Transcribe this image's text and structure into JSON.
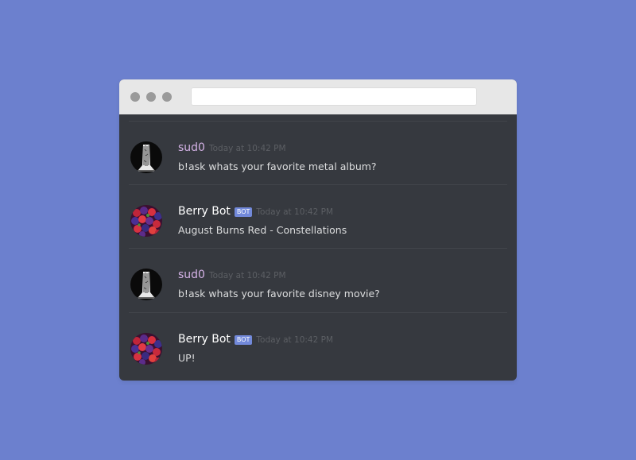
{
  "window": {
    "url": ""
  },
  "colors": {
    "background": "#6c80ce",
    "chat_background": "#36393f",
    "bot_tag": "#7289da",
    "user_name_sud0": "#d4b2e6",
    "user_name_bot": "#ffffff"
  },
  "messages": [
    {
      "username": "sud0",
      "name_color": "#d4b2e6",
      "is_bot": false,
      "bot_label": "",
      "timestamp": "Today at 10:42 PM",
      "content": "b!ask whats your favorite metal album?",
      "avatar_icon": "tree-trunk-avatar-icon"
    },
    {
      "username": "Berry Bot",
      "name_color": "#ffffff",
      "is_bot": true,
      "bot_label": "BOT",
      "timestamp": "Today at 10:42 PM",
      "content": "August Burns Red - Constellations",
      "avatar_icon": "berries-avatar-icon"
    },
    {
      "username": "sud0",
      "name_color": "#d4b2e6",
      "is_bot": false,
      "bot_label": "",
      "timestamp": "Today at 10:42 PM",
      "content": "b!ask whats your favorite disney movie?",
      "avatar_icon": "tree-trunk-avatar-icon"
    },
    {
      "username": "Berry Bot",
      "name_color": "#ffffff",
      "is_bot": true,
      "bot_label": "BOT",
      "timestamp": "Today at 10:42 PM",
      "content": "UP!",
      "avatar_icon": "berries-avatar-icon"
    }
  ]
}
